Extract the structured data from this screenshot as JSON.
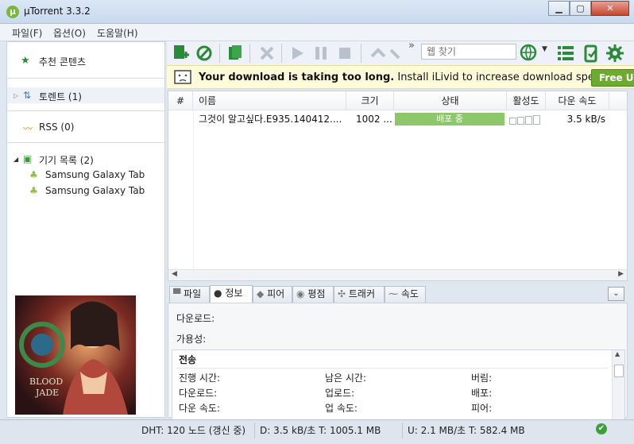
{
  "window": {
    "title": "µTorrent 3.3.2",
    "logo_glyph": "µ"
  },
  "menu": {
    "items": [
      "파일(F)",
      "옵션(O)",
      "도움말(H)"
    ]
  },
  "sidebar": {
    "featured": "추천 콘텐츠",
    "torrents": "토렌트 (1)",
    "rss": "RSS (0)",
    "devices_header": "기기 목록 (2)",
    "devices": [
      "Samsung Galaxy Tab",
      "Samsung Galaxy Tab"
    ]
  },
  "toolbar": {
    "search_placeholder": "웹 찾기",
    "overflow": "»"
  },
  "banner": {
    "bold_text": "Your download is taking too long.",
    "normal_text": " Install iLivid to increase download speed.",
    "button_label": "Free U"
  },
  "list": {
    "columns": [
      "#",
      "이름",
      "크기",
      "상태",
      "활성도",
      "다운 속도"
    ],
    "rows": [
      {
        "name": "그것이 알고싶다.E935.140412....",
        "size": "1002 ...",
        "status": "배포 중",
        "down_speed": "3.5 kB/s"
      }
    ]
  },
  "tabs": [
    "파일",
    "정보",
    "피어",
    "평점",
    "트래커",
    "속도"
  ],
  "tabs_active_index": 1,
  "info": {
    "download_label": "다운로드:",
    "availability_label": "가용성:",
    "transfer_header": "전송",
    "fields": [
      [
        "진행 시간:",
        "남은 시간:",
        "버림:"
      ],
      [
        "다운로드:",
        "업로드:",
        "배포:"
      ],
      [
        "다운 속도:",
        "업 속도:",
        "피어:"
      ]
    ]
  },
  "status": {
    "dht": "DHT: 120 노드 (갱신 중)",
    "down": "D: 3.5 kB/초 T: 1005.1 MB",
    "up": "U: 2.1 MB/초 T: 582.4 MB"
  },
  "colors": {
    "accent_green": "#6cab2f",
    "status_bar_green": "#8cc86a"
  }
}
